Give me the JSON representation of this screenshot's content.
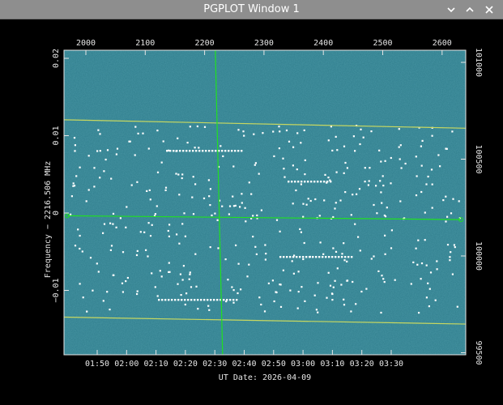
{
  "window": {
    "title": "PGPLOT Window 1",
    "buttons": {
      "minimize": "chevron-down-icon",
      "maximize": "chevron-up-icon",
      "close": "close-icon"
    },
    "colors": {
      "titlebar": "#8e8e8e",
      "background": "#000000"
    }
  },
  "chart_data": {
    "type": "heatmap",
    "description_colors": {
      "noise": "#2f7d8c",
      "detections": "#ffffff",
      "fit_lines": "#c8d860",
      "markers": "#20e020"
    },
    "ylabel": "Frequency − 2216.506 MHz",
    "xlabel": "UT Date: 2026-04-09",
    "bottom_x_ticks": [
      "01:50",
      "02:00",
      "02:10",
      "02:20",
      "02:30",
      "02:40",
      "02:50",
      "03:00",
      "03:10",
      "03:20",
      "03:30"
    ],
    "top_x_ticks": [
      "2000",
      "2100",
      "2200",
      "2300",
      "2400",
      "2500",
      "2600"
    ],
    "left_y_ticks": [
      "0.02",
      "0.01",
      "0",
      "−0.01"
    ],
    "right_y_ticks": [
      "101000",
      "100500",
      "100000",
      "99500"
    ],
    "upper_band_fit": {
      "start": 0.0113,
      "end": 0.0102
    },
    "lower_band_fit": {
      "start": -0.0144,
      "end": -0.0153
    },
    "center_line": {
      "start": -0.0012,
      "end": -0.0017
    },
    "vertical_marker": "02:31",
    "grid": false
  }
}
